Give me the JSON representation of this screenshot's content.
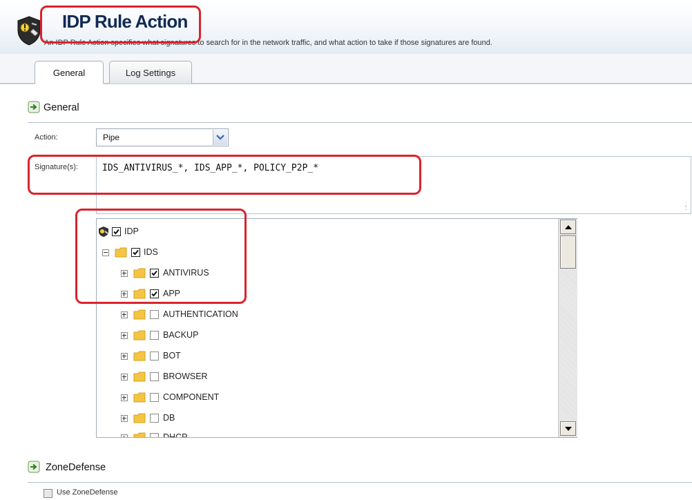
{
  "header": {
    "title": "IDP Rule Action",
    "subtitle": "An IDP Rule Action specifies what signatures to search for in the network traffic, and what action to take if those signatures are found.",
    "icon": "idp-shield-icon"
  },
  "tabs": [
    {
      "label": "General",
      "active": true
    },
    {
      "label": "Log Settings",
      "active": false
    }
  ],
  "general_section": {
    "title": "General",
    "icon": "section-arrow-icon",
    "action_label": "Action:",
    "action_value": "Pipe",
    "signatures_label": "Signature(s):",
    "signatures_value": "IDS_ANTIVIRUS_*, IDS_APP_*, POLICY_P2P_*"
  },
  "tree": {
    "items": [
      {
        "label": "IDP",
        "checked": true,
        "level": 0
      },
      {
        "label": "IDS",
        "checked": true,
        "level": 1,
        "expanded": true
      },
      {
        "label": "ANTIVIRUS",
        "checked": true,
        "level": 2
      },
      {
        "label": "APP",
        "checked": true,
        "level": 2
      },
      {
        "label": "AUTHENTICATION",
        "checked": false,
        "level": 2
      },
      {
        "label": "BACKUP",
        "checked": false,
        "level": 2
      },
      {
        "label": "BOT",
        "checked": false,
        "level": 2
      },
      {
        "label": "BROWSER",
        "checked": false,
        "level": 2
      },
      {
        "label": "COMPONENT",
        "checked": false,
        "level": 2
      },
      {
        "label": "DB",
        "checked": false,
        "level": 2
      },
      {
        "label": "DHCP",
        "checked": false,
        "level": 2
      }
    ]
  },
  "zonedefense_section": {
    "title": "ZoneDefense",
    "icon": "section-arrow-icon",
    "use_label": "Use ZoneDefense",
    "use_checked": false
  },
  "colors": {
    "title": "#112a55",
    "annotation": "#d9232d",
    "folder": "#f5c542"
  }
}
